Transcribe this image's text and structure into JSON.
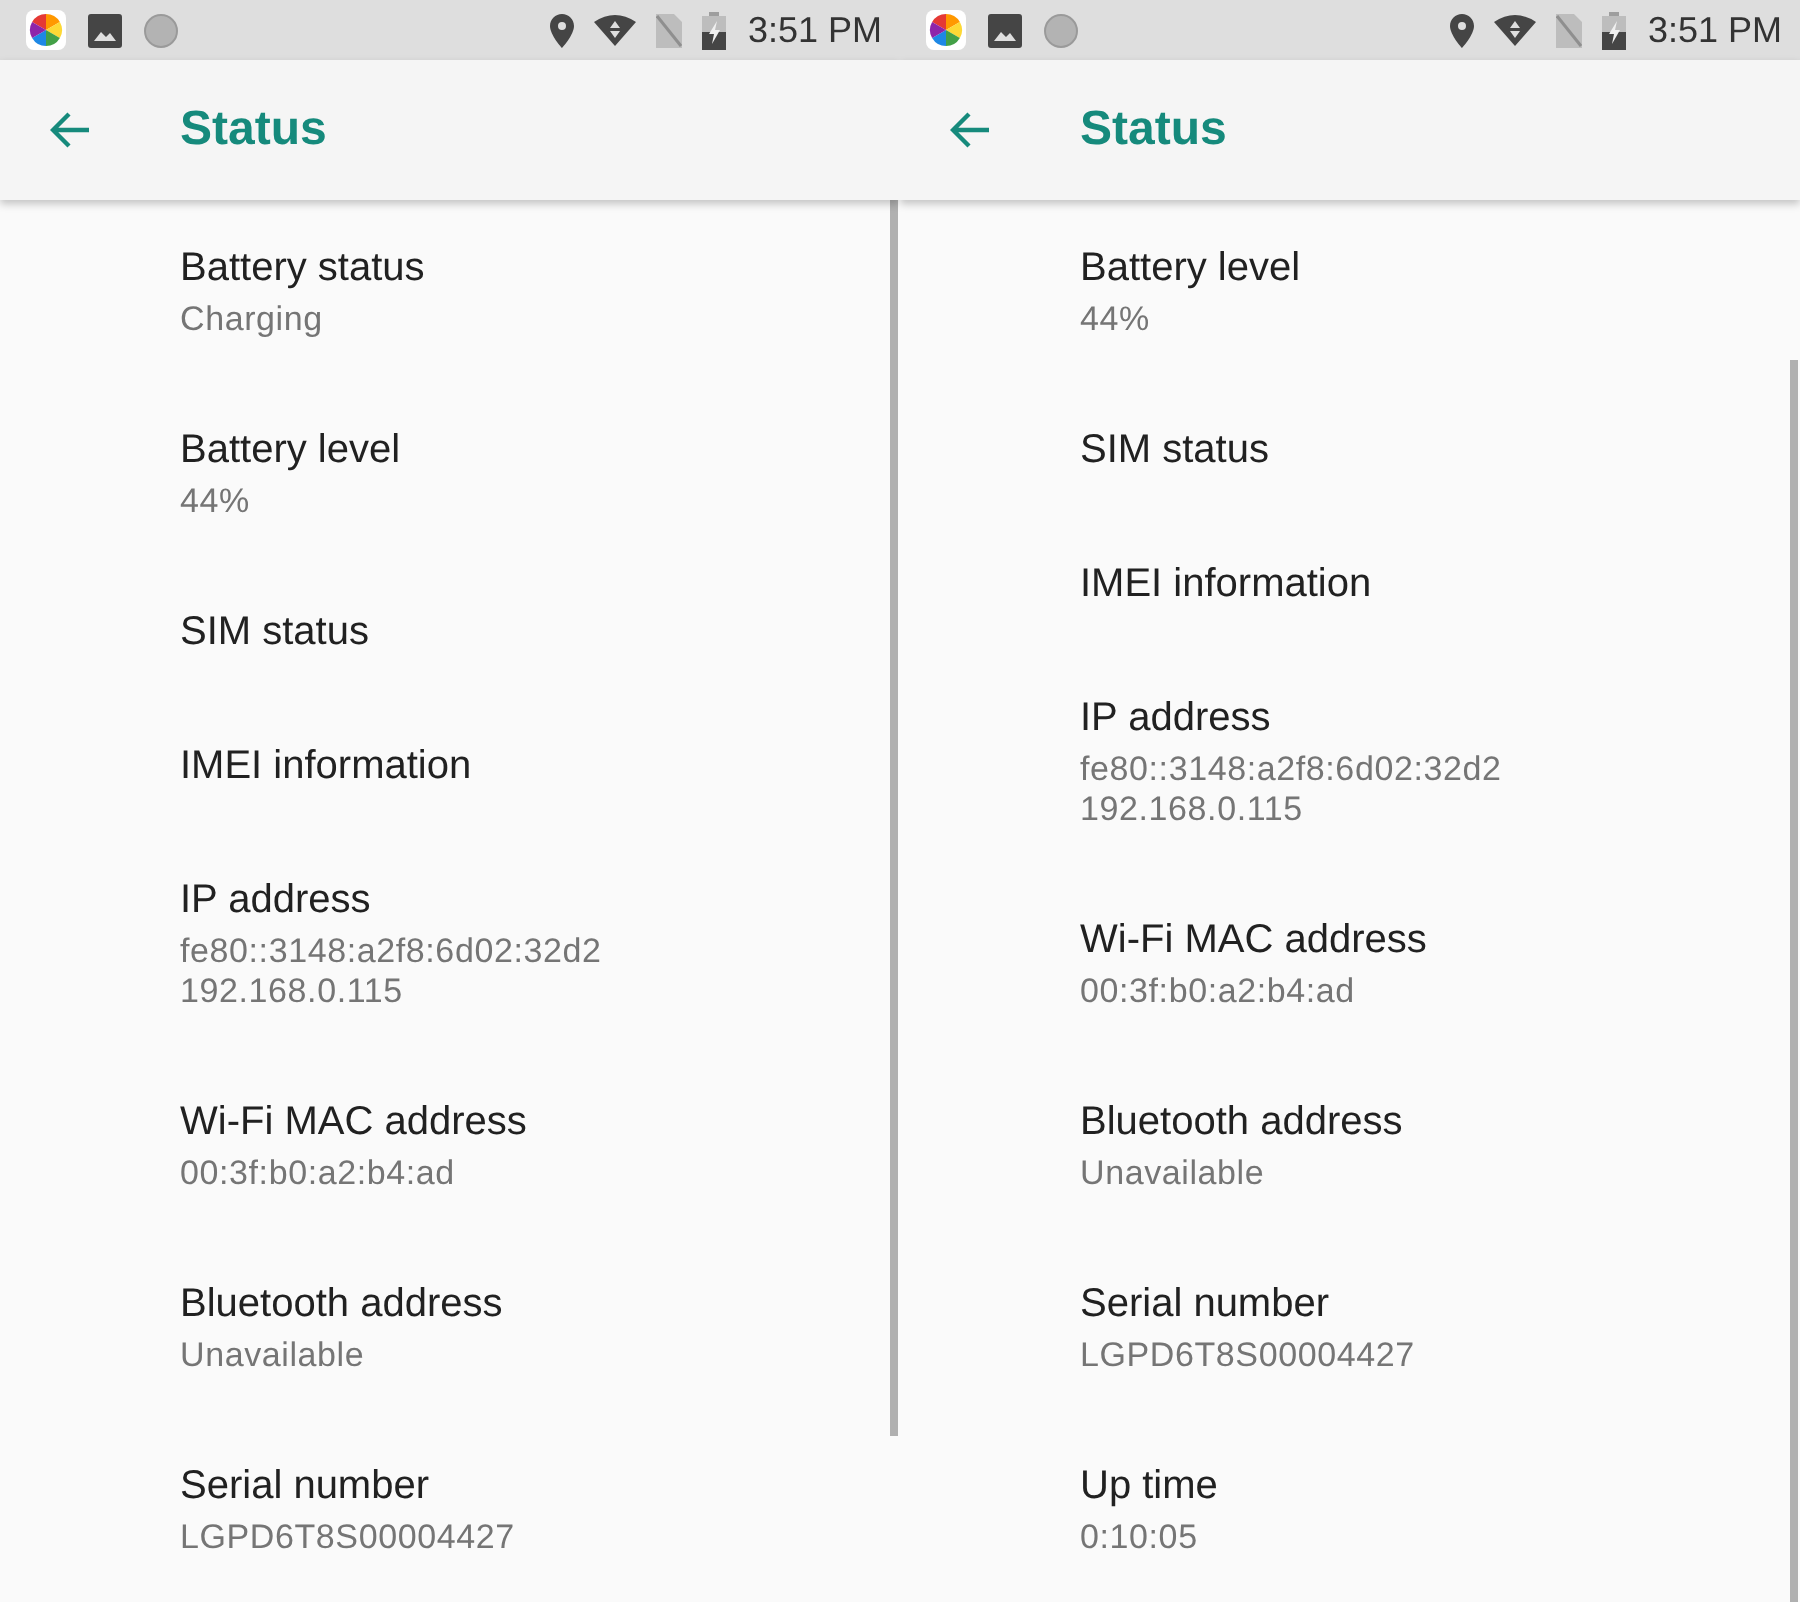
{
  "screens": [
    {
      "status_bar": {
        "time": "3:51 PM"
      },
      "app_bar": {
        "title": "Status"
      },
      "items": [
        {
          "title": "Battery status",
          "summary": [
            "Charging"
          ]
        },
        {
          "title": "Battery level",
          "summary": [
            "44%"
          ]
        },
        {
          "title": "SIM status"
        },
        {
          "title": "IMEI information"
        },
        {
          "title": "IP address",
          "summary": [
            "fe80::3148:a2f8:6d02:32d2",
            "192.168.0.115"
          ]
        },
        {
          "title": "Wi-Fi MAC address",
          "summary": [
            "00:3f:b0:a2:b4:ad"
          ]
        },
        {
          "title": "Bluetooth address",
          "summary": [
            "Unavailable"
          ]
        },
        {
          "title": "Serial number",
          "summary": [
            "LGPD6T8S00004427"
          ]
        }
      ]
    },
    {
      "status_bar": {
        "time": "3:51 PM"
      },
      "app_bar": {
        "title": "Status"
      },
      "items": [
        {
          "title": "Battery level",
          "summary": [
            "44%"
          ]
        },
        {
          "title": "SIM status"
        },
        {
          "title": "IMEI information"
        },
        {
          "title": "IP address",
          "summary": [
            "fe80::3148:a2f8:6d02:32d2",
            "192.168.0.115"
          ]
        },
        {
          "title": "Wi-Fi MAC address",
          "summary": [
            "00:3f:b0:a2:b4:ad"
          ]
        },
        {
          "title": "Bluetooth address",
          "summary": [
            "Unavailable"
          ]
        },
        {
          "title": "Serial number",
          "summary": [
            "LGPD6T8S00004427"
          ]
        },
        {
          "title": "Up time",
          "summary": [
            "0:10:05"
          ]
        }
      ]
    }
  ]
}
